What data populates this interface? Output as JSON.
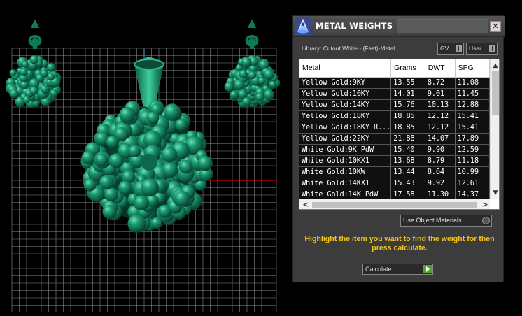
{
  "panel": {
    "title": "METAL WEIGHTS",
    "close_glyph": "✕",
    "library_label": "Library: Cutout White - (Fast)-Metal",
    "gv_dropdown": "GV",
    "user_dropdown": "User",
    "app_icon": "rhino-app-icon"
  },
  "table": {
    "columns": [
      "Metal",
      "Grams",
      "DWT",
      "SPG"
    ],
    "rows": [
      [
        "Yellow Gold:9KY",
        "13.55",
        "8.72",
        "11.08"
      ],
      [
        "Yellow Gold:10KY",
        "14.01",
        "9.01",
        "11.45"
      ],
      [
        "Yellow Gold:14KY",
        "15.76",
        "10.13",
        "12.88"
      ],
      [
        "Yellow Gold:18KY",
        "18.85",
        "12.12",
        "15.41"
      ],
      [
        "Yellow Gold:18KY R...",
        "18.85",
        "12.12",
        "15.41"
      ],
      [
        "Yellow Gold:22KY",
        "21.88",
        "14.07",
        "17.89"
      ],
      [
        "White Gold:9K PdW",
        "15.40",
        "9.90",
        "12.59"
      ],
      [
        "White Gold:10KX1",
        "13.68",
        "8.79",
        "11.18"
      ],
      [
        "White Gold:10KW",
        "13.44",
        "8.64",
        "10.99"
      ],
      [
        "White Gold:14KX1",
        "15.43",
        "9.92",
        "12.61"
      ],
      [
        "White Gold:14K PdW",
        "17.58",
        "11.30",
        "14.37"
      ]
    ],
    "scroll_up": "▲",
    "scroll_down": "▼",
    "scroll_left": "<",
    "scroll_right": ">"
  },
  "controls": {
    "object_materials_dropdown": "Use Object Materials",
    "instructions": "Highlight the item you want to find the weight for then press calculate.",
    "calculate_label": "Calculate"
  },
  "colors": {
    "accent_yellow": "#f5c518",
    "jewel_green": "#0f7a5a",
    "grid_line": "#8a8a8a",
    "axis_red": "#c00000"
  }
}
